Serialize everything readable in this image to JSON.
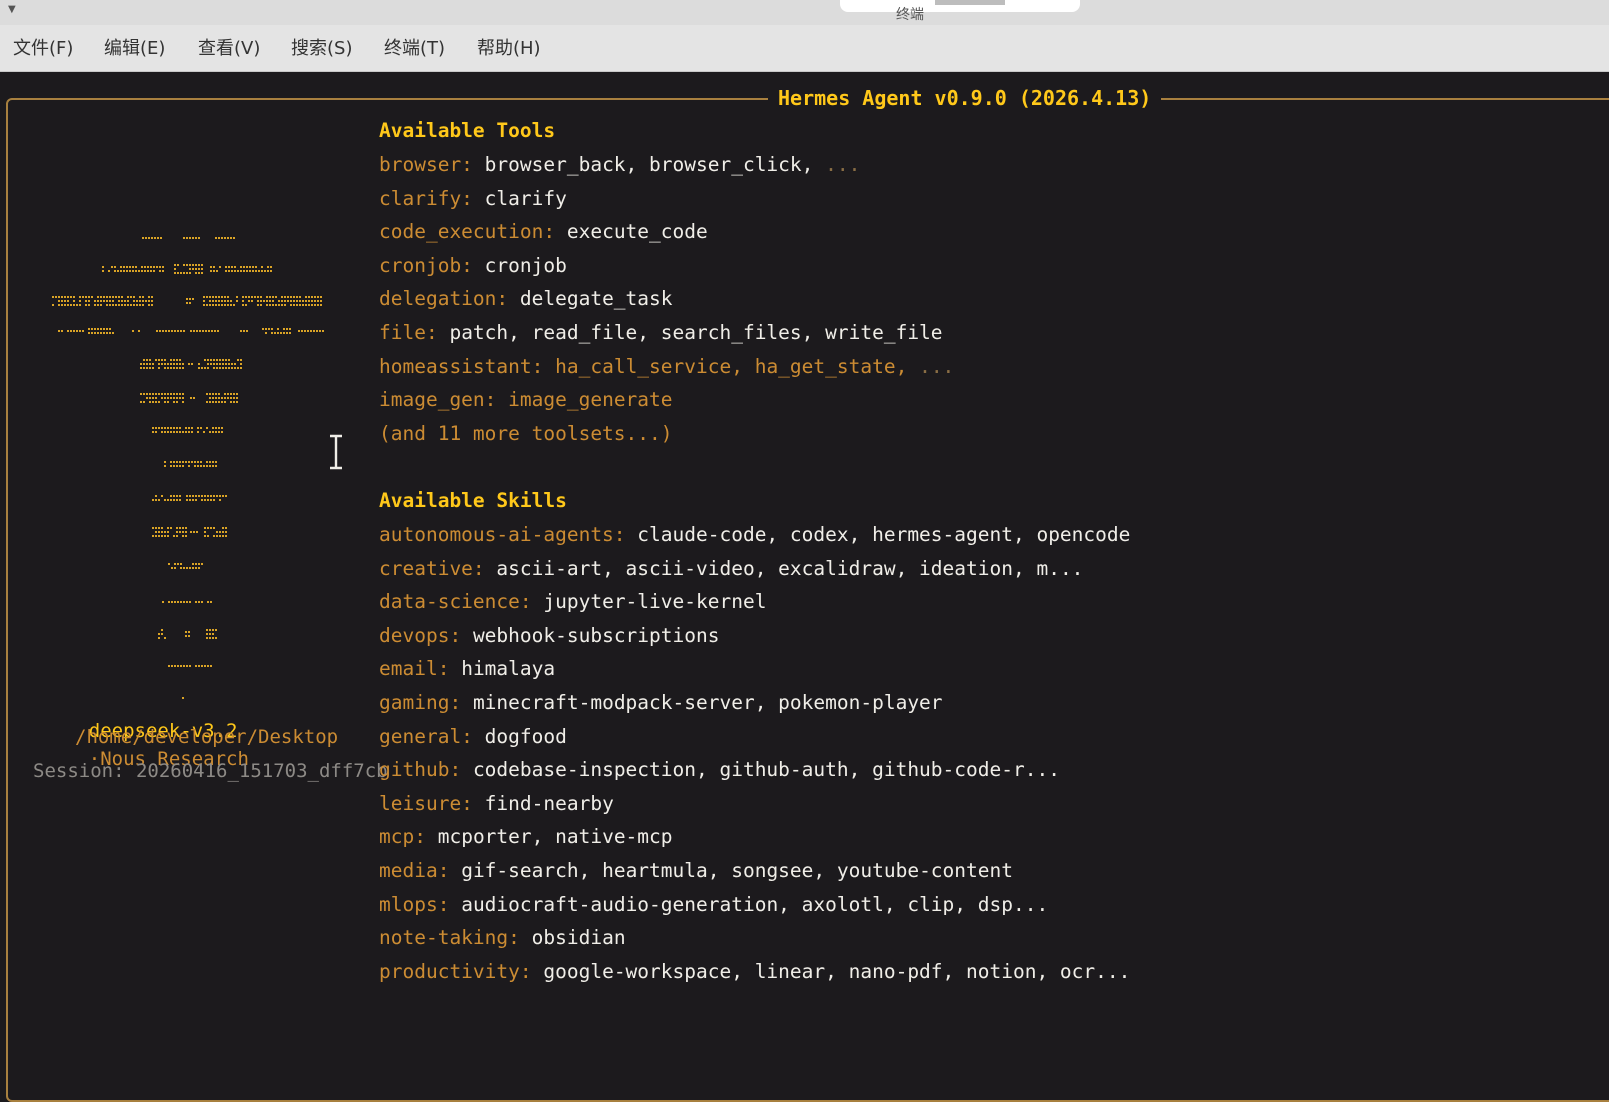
{
  "window": {
    "title": "终端"
  },
  "menu": [
    "文件(F)",
    "编辑(E)",
    "查看(V)",
    "搜索(S)",
    "终端(T)",
    "帮助(H)"
  ],
  "banner": "Hermes Agent v0.9.0 (2026.4.13)",
  "sidebar": {
    "model": "deepseek-v3.2",
    "separator": "·",
    "org": "Nous Research",
    "cwd": "/home/developer/Desktop",
    "session": "Session: 20260416_151703_dff7cb"
  },
  "tools": {
    "heading": "Available Tools",
    "rows": [
      {
        "key": "browser:",
        "value": "browser_back, browser_click,",
        "tail": "..."
      },
      {
        "key": "clarify:",
        "value": "clarify"
      },
      {
        "key": "code_execution:",
        "value": "execute_code"
      },
      {
        "key": "cronjob:",
        "value": "cronjob"
      },
      {
        "key": "delegation:",
        "value": "delegate_task"
      },
      {
        "key": "file:",
        "value": "patch, read_file, search_files, write_file"
      },
      {
        "key": "homeassistant:",
        "dim": "ha_call_service, ha_get_state,",
        "tail": "..."
      },
      {
        "key": "image_gen:",
        "dim": "image_generate"
      },
      {
        "key": "",
        "dim": "(and 11 more toolsets...)"
      }
    ]
  },
  "skills": {
    "heading": "Available Skills",
    "rows": [
      {
        "key": "autonomous-ai-agents:",
        "value": "claude-code, codex, hermes-agent, opencode"
      },
      {
        "key": "creative:",
        "value": "ascii-art, ascii-video, excalidraw, ideation, m..."
      },
      {
        "key": "data-science:",
        "value": "jupyter-live-kernel"
      },
      {
        "key": "devops:",
        "value": "webhook-subscriptions"
      },
      {
        "key": "email:",
        "value": "himalaya"
      },
      {
        "key": "gaming:",
        "value": "minecraft-modpack-server, pokemon-player"
      },
      {
        "key": "general:",
        "value": "dogfood"
      },
      {
        "key": "github:",
        "value": "codebase-inspection, github-auth, github-code-r..."
      },
      {
        "key": "leisure:",
        "value": "find-nearby"
      },
      {
        "key": "mcp:",
        "value": "mcporter, native-mcp"
      },
      {
        "key": "media:",
        "value": "gif-search, heartmula, songsee, youtube-content"
      },
      {
        "key": "mlops:",
        "value": "audiocraft-audio-generation, axolotl, clip, dsp..."
      },
      {
        "key": "note-taking:",
        "value": "obsidian"
      },
      {
        "key": "productivity:",
        "value": "google-workspace, linear, nano-pdf, notion, ocr..."
      }
    ]
  },
  "colors": {
    "background": "#1c1a1d",
    "heading": "#ffc81a",
    "key": "#cc8c33",
    "value": "#f0eee8",
    "border": "#a8803f"
  },
  "icons": [
    "dropdown-arrow-icon",
    "hermes-ascii-logo",
    "text-cursor-icon"
  ]
}
